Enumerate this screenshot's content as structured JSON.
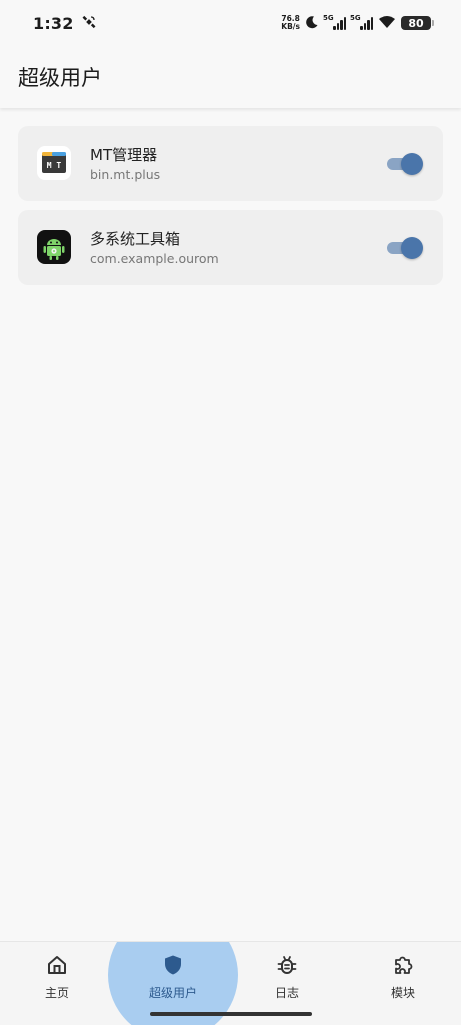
{
  "status_bar": {
    "time": "1:32",
    "net_speed_value": "76.8",
    "net_speed_unit": "KB/s",
    "sim1_label": "5G",
    "sim2_label": "5G",
    "battery": "80"
  },
  "app_bar": {
    "title": "超级用户"
  },
  "apps": [
    {
      "name": "MT管理器",
      "package": "bin.mt.plus",
      "enabled": true,
      "icon": "mt-manager-icon"
    },
    {
      "name": "多系统工具箱",
      "package": "com.example.ourom",
      "enabled": true,
      "icon": "android-robot-icon"
    }
  ],
  "nav": {
    "items": [
      {
        "label": "主页",
        "icon": "home-icon"
      },
      {
        "label": "超级用户",
        "icon": "shield-icon",
        "active": true
      },
      {
        "label": "日志",
        "icon": "bug-icon"
      },
      {
        "label": "模块",
        "icon": "puzzle-icon"
      }
    ]
  },
  "colors": {
    "accent": "#4a75aa",
    "accent_light": "#a9cdf0",
    "track": "#8aa4c4"
  }
}
